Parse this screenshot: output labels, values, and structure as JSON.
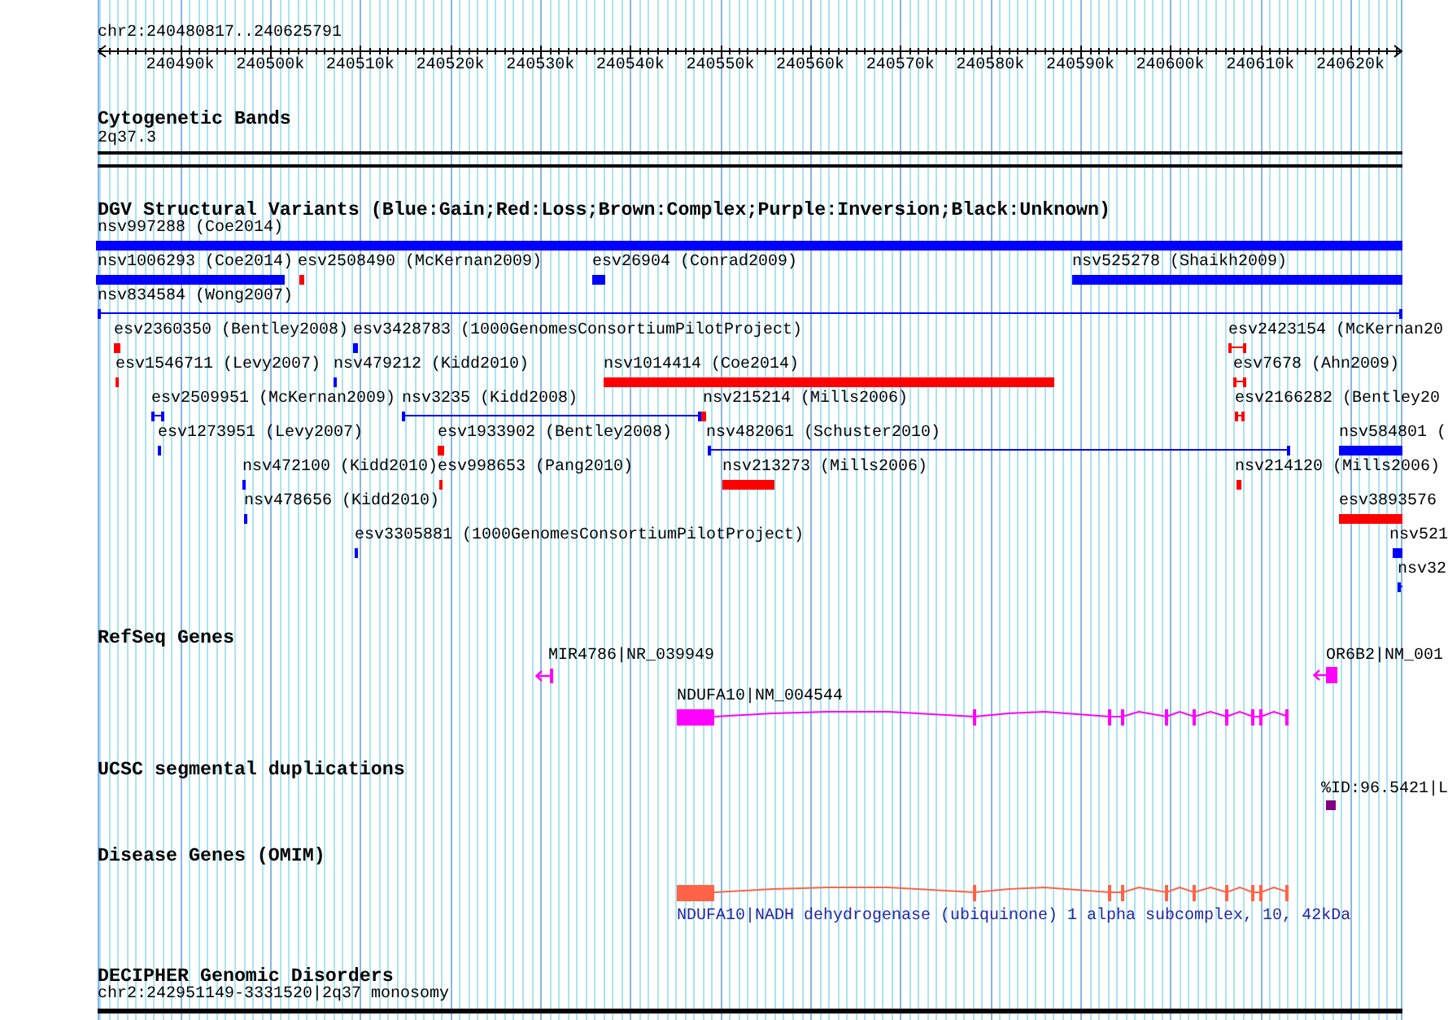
{
  "ruler": {
    "position": "chr2:240480817..240625791",
    "ticks": [
      "240490k",
      "240500k",
      "240510k",
      "240520k",
      "240530k",
      "240540k",
      "240550k",
      "240560k",
      "240570k",
      "240580k",
      "240590k",
      "240600k",
      "240610k",
      "240620k"
    ]
  },
  "cytogenetic_bands": {
    "title": "Cytogenetic Bands",
    "bands": [
      {
        "label": "2q37.3"
      }
    ]
  },
  "dgv_structural_variants": {
    "title": "DGV Structural Variants (Blue:Gain;Red:Loss;Brown:Complex;Purple:Inversion;Black:Unknown)",
    "variants": [
      {
        "label": "nsv997288 (Coe2014)",
        "kind": "bar",
        "color": "#0000ff"
      },
      {
        "label": "nsv1006293 (Coe2014)",
        "kind": "bar",
        "color": "#0000ff"
      },
      {
        "label": "esv2508490 (McKernan2009)",
        "kind": "bar",
        "color": "#ff0000"
      },
      {
        "label": "esv26904 (Conrad2009)",
        "kind": "bar",
        "color": "#0000ff"
      },
      {
        "label": "nsv525278 (Shaikh2009)",
        "kind": "bar",
        "color": "#0000ff"
      },
      {
        "label": "nsv834584 (Wong2007)",
        "kind": "interval",
        "color": "#0000ff"
      },
      {
        "label": "esv2360350 (Bentley2008)",
        "kind": "bar",
        "color": "#ff0000"
      },
      {
        "label": "esv3428783 (1000GenomesConsortiumPilotProject)",
        "kind": "bar",
        "color": "#0000ff"
      },
      {
        "label": "esv2423154 (McKernan20",
        "kind": "interval",
        "color": "#ff0000"
      },
      {
        "label": "esv1546711 (Levy2007)",
        "kind": "bar",
        "color": "#ff0000"
      },
      {
        "label": "nsv479212 (Kidd2010)",
        "kind": "bar",
        "color": "#0000ff"
      },
      {
        "label": "nsv1014414 (Coe2014)",
        "kind": "bar",
        "color": "#ff0000"
      },
      {
        "label": "esv7678 (Ahn2009)",
        "kind": "interval",
        "color": "#ff0000"
      },
      {
        "label": "esv2509951 (McKernan2009)",
        "kind": "interval",
        "color": "#0000ff"
      },
      {
        "label": "nsv3235 (Kidd2008)",
        "kind": "interval",
        "color": "#0000ff"
      },
      {
        "label": "nsv215214 (Mills2006)",
        "kind": "bar",
        "color": "#ff0000"
      },
      {
        "label": "esv2166282 (Bentley20",
        "kind": "interval",
        "color": "#ff0000"
      },
      {
        "label": "esv1273951 (Levy2007)",
        "kind": "bar",
        "color": "#0000ff"
      },
      {
        "label": "esv1933902 (Bentley2008)",
        "kind": "bar",
        "color": "#ff0000"
      },
      {
        "label": "nsv482061 (Schuster2010)",
        "kind": "interval",
        "color": "#0000ff"
      },
      {
        "label": "nsv584801 (",
        "kind": "bar",
        "color": "#0000ff"
      },
      {
        "label": "nsv472100 (Kidd2010)",
        "kind": "bar",
        "color": "#0000ff"
      },
      {
        "label": "esv998653 (Pang2010)",
        "kind": "bar",
        "color": "#ff0000"
      },
      {
        "label": "nsv213273 (Mills2006)",
        "kind": "bar",
        "color": "#ff0000"
      },
      {
        "label": "nsv214120 (Mills2006)",
        "kind": "bar",
        "color": "#ff0000"
      },
      {
        "label": "nsv478656 (Kidd2010)",
        "kind": "bar",
        "color": "#0000ff"
      },
      {
        "label": "esv3893576",
        "kind": "bar",
        "color": "#ff0000"
      },
      {
        "label": "esv3305881 (1000GenomesConsortiumPilotProject)",
        "kind": "bar",
        "color": "#0000ff"
      },
      {
        "label": "nsv521",
        "kind": "bar",
        "color": "#0000ff"
      },
      {
        "label": "nsv32",
        "kind": "interval",
        "color": "#0000ff"
      }
    ]
  },
  "refseq_genes": {
    "title": "RefSeq Genes",
    "genes": [
      {
        "label": "MIR4786|NR_039949",
        "kind": "arrow"
      },
      {
        "label": "OR6B2|NM_001",
        "kind": "arrow"
      },
      {
        "label": "NDUFA10|NM_004544",
        "kind": "exons"
      }
    ]
  },
  "segmental_duplications": {
    "title": "UCSC segmental duplications",
    "items": [
      {
        "label": "%ID:96.5421|L"
      }
    ]
  },
  "disease_genes": {
    "title": "Disease Genes (OMIM)",
    "genes": [
      {
        "label": "NDUFA10|NADH dehydrogenase (ubiquinone) 1 alpha subcomplex, 10, 42kDa"
      }
    ]
  },
  "decipher_disorders": {
    "title": "DECIPHER Genomic Disorders",
    "items": [
      {
        "label": "chr2:242951149-3331520|2q37 monosomy"
      }
    ]
  }
}
